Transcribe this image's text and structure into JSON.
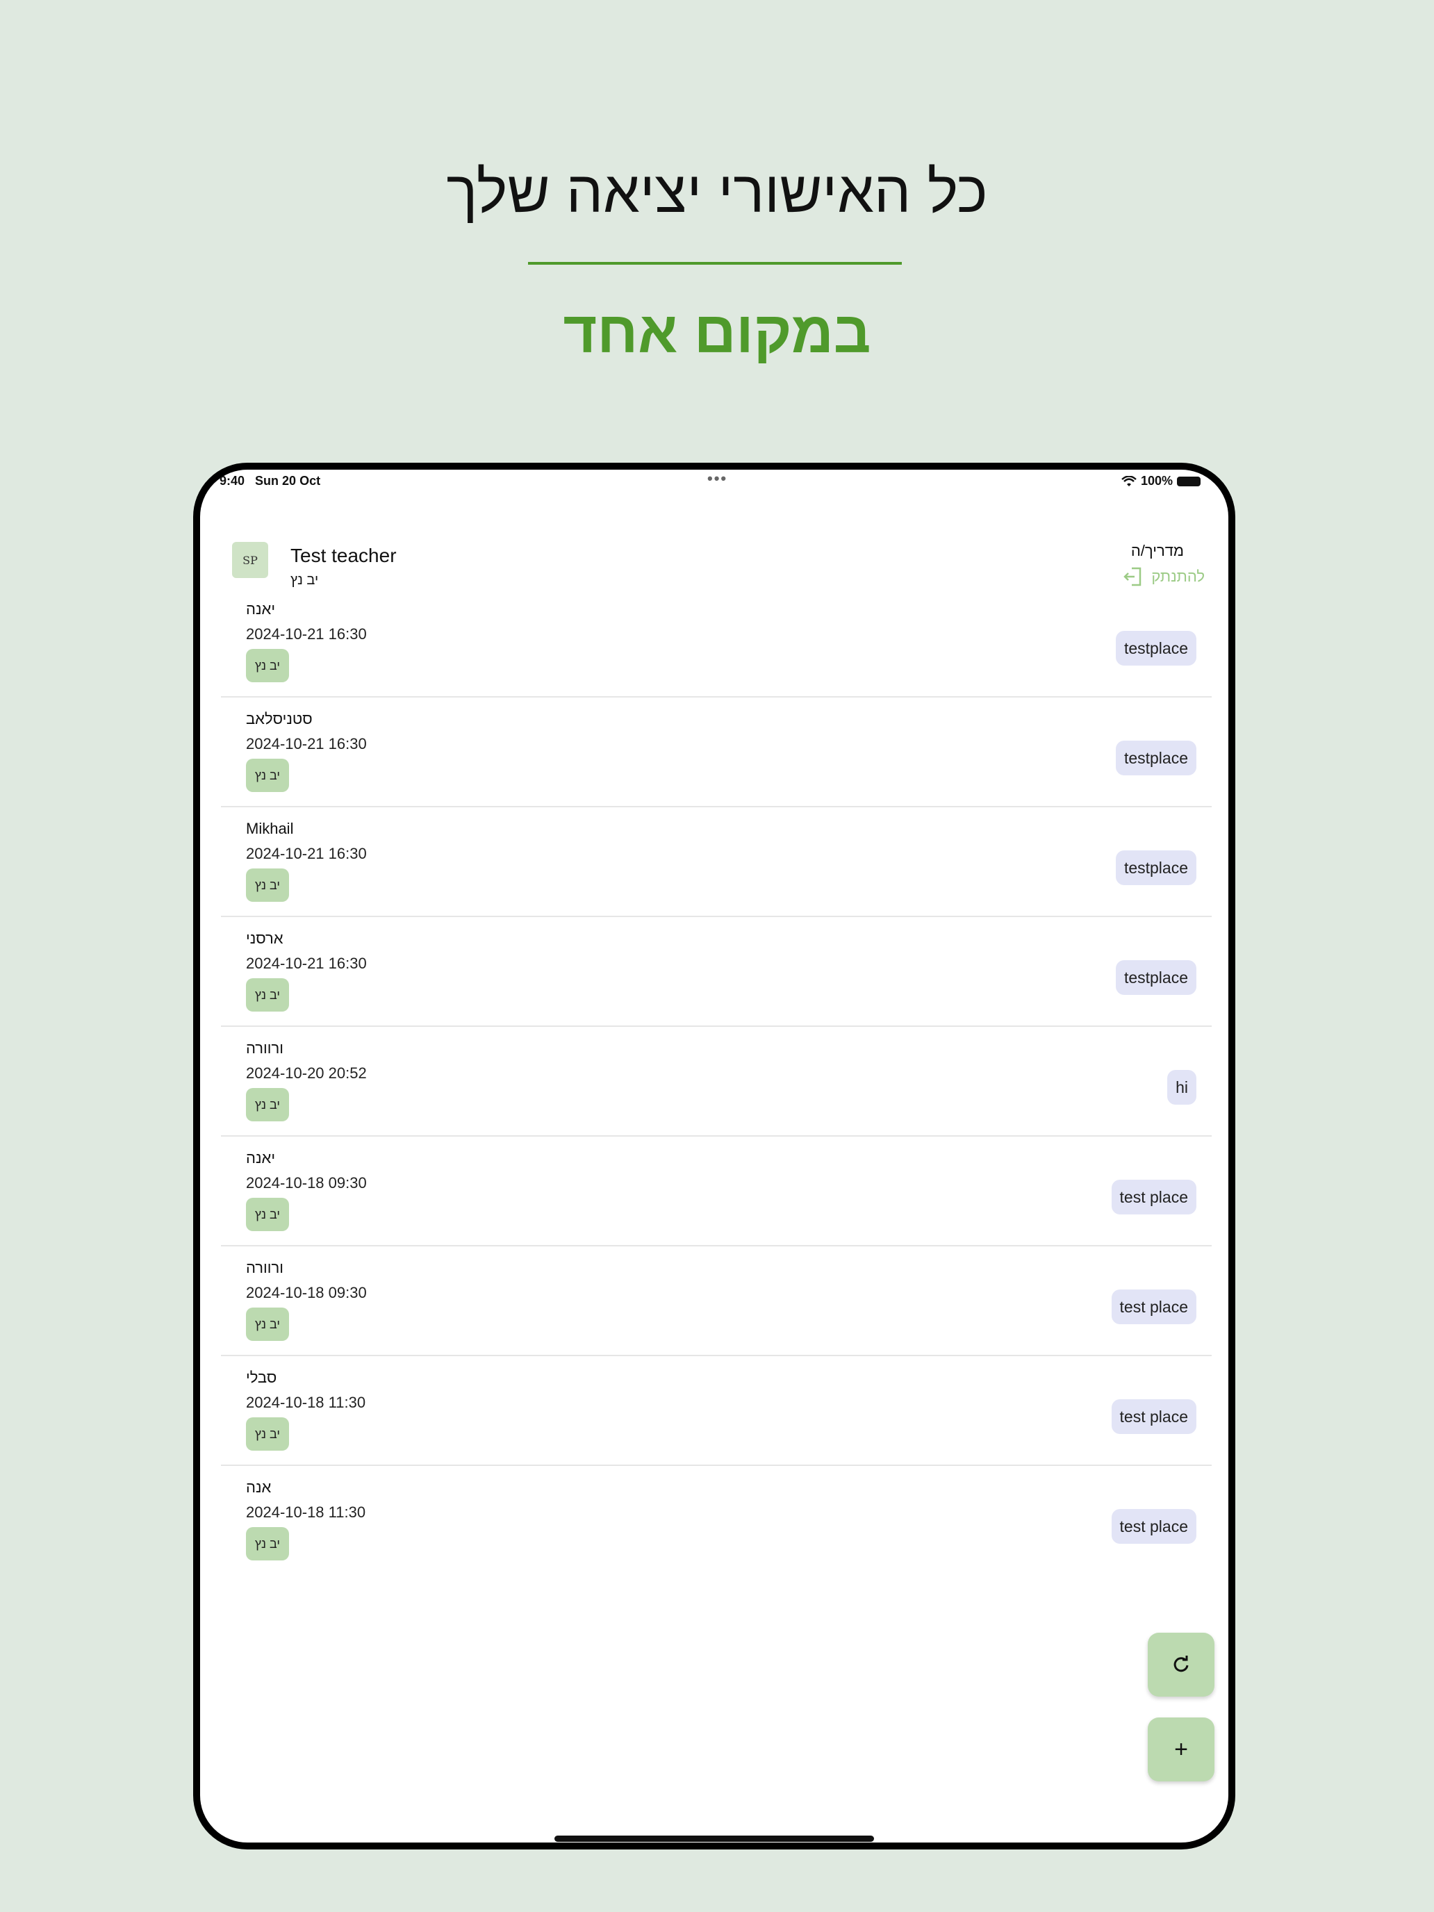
{
  "headline": "כל האישורי יציאה שלך",
  "subheadline": "במקום אחד",
  "status_bar": {
    "time": "9:40",
    "date": "Sun 20 Oct",
    "battery": "100%"
  },
  "header": {
    "logo_text": "SP",
    "user_name": "Test teacher",
    "user_class": "יב נץ",
    "role": "מדריך/ה",
    "logout_label": "להתנתק"
  },
  "passes": [
    {
      "name": "יאנה",
      "datetime": "2024-10-21 16:30",
      "class": "יב נץ",
      "place": "testplace"
    },
    {
      "name": "סטניסלאב",
      "datetime": "2024-10-21 16:30",
      "class": "יב נץ",
      "place": "testplace"
    },
    {
      "name": "Mikhail",
      "datetime": "2024-10-21 16:30",
      "class": "יב נץ",
      "place": "testplace"
    },
    {
      "name": "ארסני",
      "datetime": "2024-10-21 16:30",
      "class": "יב נץ",
      "place": "testplace"
    },
    {
      "name": "ורוורה",
      "datetime": "2024-10-20 20:52",
      "class": "יב נץ",
      "place": "hi"
    },
    {
      "name": "יאנה",
      "datetime": "2024-10-18 09:30",
      "class": "יב נץ",
      "place": "test place"
    },
    {
      "name": "ורוורה",
      "datetime": "2024-10-18 09:30",
      "class": "יב נץ",
      "place": "test place"
    },
    {
      "name": "סבלי",
      "datetime": "2024-10-18 11:30",
      "class": "יב נץ",
      "place": "test place"
    },
    {
      "name": "אנה",
      "datetime": "2024-10-18 11:30",
      "class": "יב נץ",
      "place": "test place"
    }
  ],
  "fab": {
    "refresh_icon": "refresh-icon",
    "add_symbol": "+"
  },
  "colors": {
    "page_bg": "#dfe9e0",
    "brand_green": "#4f9a2b",
    "chip_green": "#bcdab0",
    "place_chip": "#e2e4f6"
  }
}
